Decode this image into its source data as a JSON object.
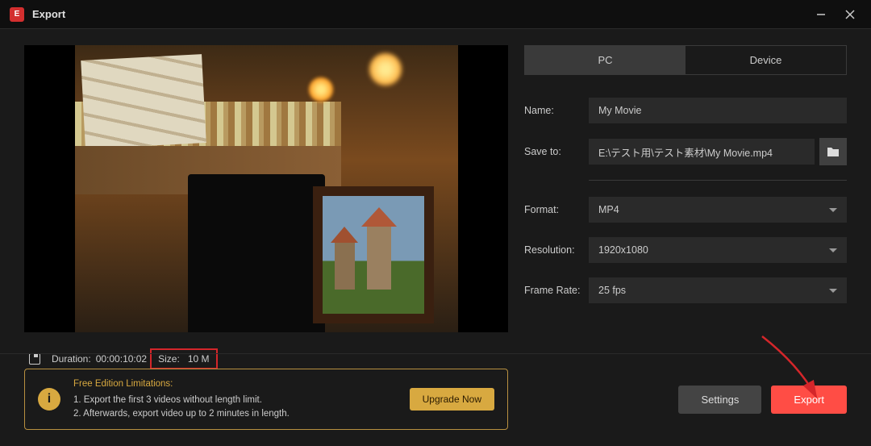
{
  "titlebar": {
    "title": "Export"
  },
  "tabs": {
    "pc": "PC",
    "device": "Device"
  },
  "fields": {
    "name_label": "Name:",
    "name_value": "My Movie",
    "saveto_label": "Save to:",
    "saveto_value": "E:\\テスト用\\テスト素材\\My Movie.mp4",
    "format_label": "Format:",
    "format_value": "MP4",
    "resolution_label": "Resolution:",
    "resolution_value": "1920x1080",
    "framerate_label": "Frame Rate:",
    "framerate_value": "25 fps"
  },
  "meta": {
    "duration_label": "Duration:",
    "duration_value": "00:00:10:02",
    "size_label": "Size:",
    "size_value": "10 M"
  },
  "limitations": {
    "title": "Free Edition Limitations:",
    "line1": "1. Export the first 3 videos without length limit.",
    "line2": "2. Afterwards, export video up to 2 minutes in length.",
    "upgrade": "Upgrade Now"
  },
  "footer": {
    "settings": "Settings",
    "export": "Export"
  }
}
